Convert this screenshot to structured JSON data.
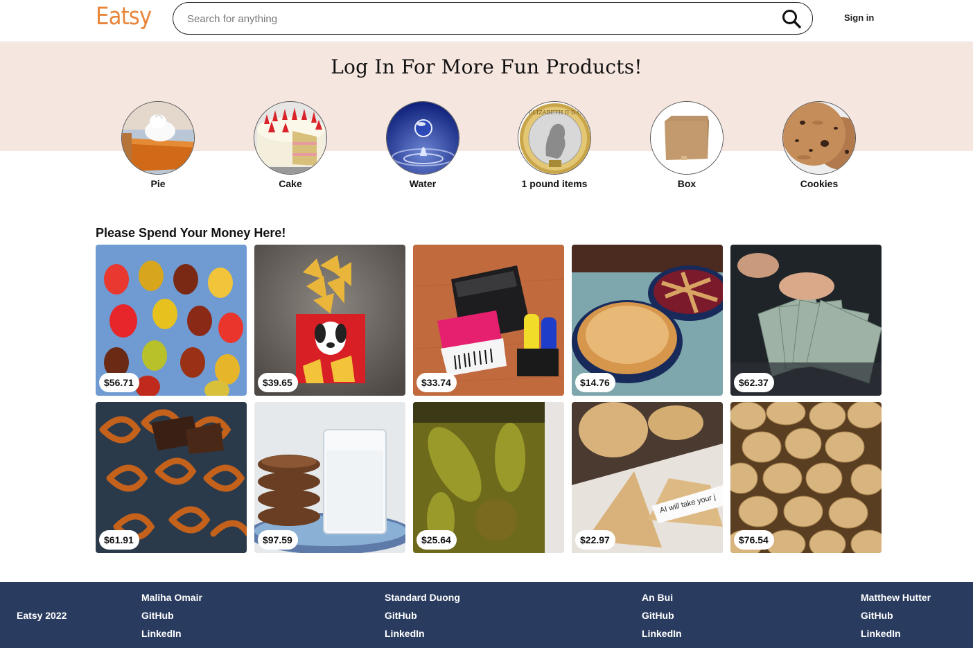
{
  "header": {
    "logo": "Eatsy",
    "search_placeholder": "Search for anything",
    "search_value": "",
    "search_icon": "search-icon",
    "sign_in_label": "Sign in"
  },
  "banner": {
    "title": "Log In For More Fun Products!"
  },
  "categories": [
    {
      "label": "Pie",
      "image": "pie"
    },
    {
      "label": "Cake",
      "image": "cake"
    },
    {
      "label": "Water",
      "image": "water-drop"
    },
    {
      "label": "1 pound items",
      "image": "pound-coin"
    },
    {
      "label": "Box",
      "image": "cardboard-box"
    },
    {
      "label": "Cookies",
      "image": "cookies"
    }
  ],
  "products_section": {
    "title": "Please Spend Your Money Here!",
    "items": [
      {
        "price": "$56.71",
        "image": "gummy-bears"
      },
      {
        "price": "$39.65",
        "image": "chips-bag"
      },
      {
        "price": "$33.74",
        "image": "label-printer"
      },
      {
        "price": "$14.76",
        "image": "pies"
      },
      {
        "price": "$62.37",
        "image": "cash"
      },
      {
        "price": "$61.91",
        "image": "chocolate-pretzels"
      },
      {
        "price": "$97.59",
        "image": "cookies-and-milk"
      },
      {
        "price": "$25.64",
        "image": "pickles-jar"
      },
      {
        "price": "$22.97",
        "image": "fortune-cookies",
        "caption": "AI will take your j"
      },
      {
        "price": "$76.54",
        "image": "potatoes"
      }
    ]
  },
  "footer": {
    "brand": "Eatsy 2022",
    "members": [
      {
        "name": "Maliha Omair",
        "github": "GitHub",
        "linkedin": "LinkedIn"
      },
      {
        "name": "Standard Duong",
        "github": "GitHub",
        "linkedin": "LinkedIn"
      },
      {
        "name": "An Bui",
        "github": "GitHub",
        "linkedin": "LinkedIn"
      },
      {
        "name": "Matthew Hutter",
        "github": "GitHub",
        "linkedin": "LinkedIn"
      }
    ]
  },
  "colors": {
    "logo": "#e8853a",
    "banner_bg": "#f6e6e0",
    "footer_bg": "#293b5f"
  }
}
